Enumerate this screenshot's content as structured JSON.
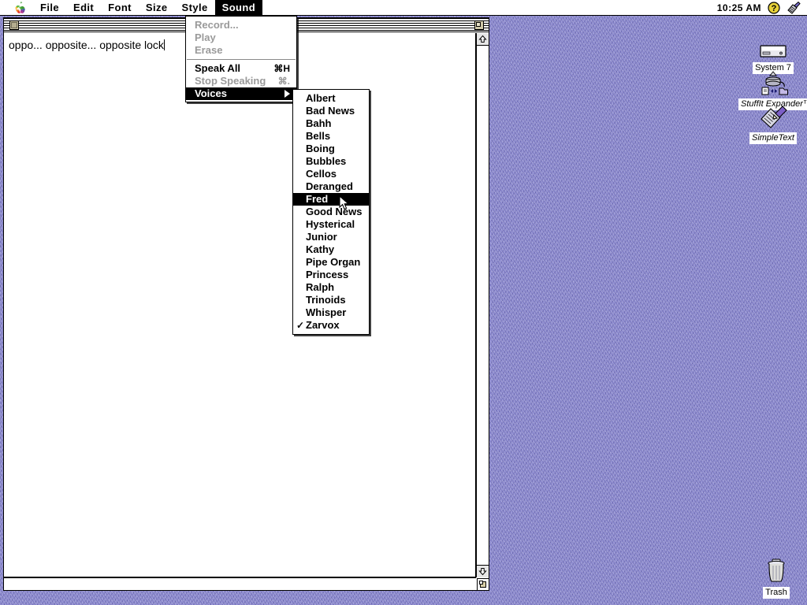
{
  "menubar": {
    "apple_icon": "apple-logo-icon",
    "items": [
      {
        "label": "File",
        "selected": false
      },
      {
        "label": "Edit",
        "selected": false
      },
      {
        "label": "Font",
        "selected": false
      },
      {
        "label": "Size",
        "selected": false
      },
      {
        "label": "Style",
        "selected": false
      },
      {
        "label": "Sound",
        "selected": true
      }
    ],
    "clock": "10:25 AM",
    "help_icon": "help-question-icon",
    "application_icon": "application-switcher-icon"
  },
  "window": {
    "title": "",
    "close_box": "close-box-icon",
    "zoom_box": "zoom-box-icon",
    "document_text": "oppo... opposite... opposite lock",
    "scroll_up_icon": "scroll-up-arrow-icon",
    "scroll_down_icon": "scroll-down-arrow-icon",
    "grow_box_icon": "resize-grow-box-icon"
  },
  "sound_menu": {
    "title": "Sound",
    "items": [
      {
        "label": "Record...",
        "shortcut": "",
        "state": "disabled",
        "separator_after": false
      },
      {
        "label": "Play",
        "shortcut": "",
        "state": "disabled",
        "separator_after": false
      },
      {
        "label": "Erase",
        "shortcut": "",
        "state": "disabled",
        "separator_after": true
      },
      {
        "label": "Speak All",
        "shortcut": "⌘H",
        "state": "enabled",
        "separator_after": false
      },
      {
        "label": "Stop Speaking",
        "shortcut": "⌘.",
        "state": "disabled",
        "separator_after": false
      },
      {
        "label": "Voices",
        "shortcut": "",
        "state": "highlight-submenu",
        "separator_after": false
      }
    ]
  },
  "voices_menu": {
    "items": [
      {
        "label": "Albert",
        "checked": false,
        "highlight": false
      },
      {
        "label": "Bad News",
        "checked": false,
        "highlight": false
      },
      {
        "label": "Bahh",
        "checked": false,
        "highlight": false
      },
      {
        "label": "Bells",
        "checked": false,
        "highlight": false
      },
      {
        "label": "Boing",
        "checked": false,
        "highlight": false
      },
      {
        "label": "Bubbles",
        "checked": false,
        "highlight": false
      },
      {
        "label": "Cellos",
        "checked": false,
        "highlight": false
      },
      {
        "label": "Deranged",
        "checked": false,
        "highlight": false
      },
      {
        "label": "Fred",
        "checked": false,
        "highlight": true
      },
      {
        "label": "Good News",
        "checked": false,
        "highlight": false
      },
      {
        "label": "Hysterical",
        "checked": false,
        "highlight": false
      },
      {
        "label": "Junior",
        "checked": false,
        "highlight": false
      },
      {
        "label": "Kathy",
        "checked": false,
        "highlight": false
      },
      {
        "label": "Pipe Organ",
        "checked": false,
        "highlight": false
      },
      {
        "label": "Princess",
        "checked": false,
        "highlight": false
      },
      {
        "label": "Ralph",
        "checked": false,
        "highlight": false
      },
      {
        "label": "Trinoids",
        "checked": false,
        "highlight": false
      },
      {
        "label": "Whisper",
        "checked": false,
        "highlight": false
      },
      {
        "label": "Zarvox",
        "checked": true,
        "highlight": false
      }
    ],
    "check_mark": "✓"
  },
  "desktop": {
    "icons": [
      {
        "name": "System 7",
        "icon": "hard-disk-icon",
        "italic": false
      },
      {
        "name": "StuffIt Expander™",
        "icon": "stuffit-expander-icon",
        "italic": true
      },
      {
        "name": "SimpleText",
        "icon": "simpletext-app-icon",
        "italic": true
      },
      {
        "name": "Trash",
        "icon": "trash-can-icon",
        "italic": false
      }
    ],
    "background_color": "#8d8bd0"
  },
  "cursor": {
    "type": "arrow-pointer"
  }
}
